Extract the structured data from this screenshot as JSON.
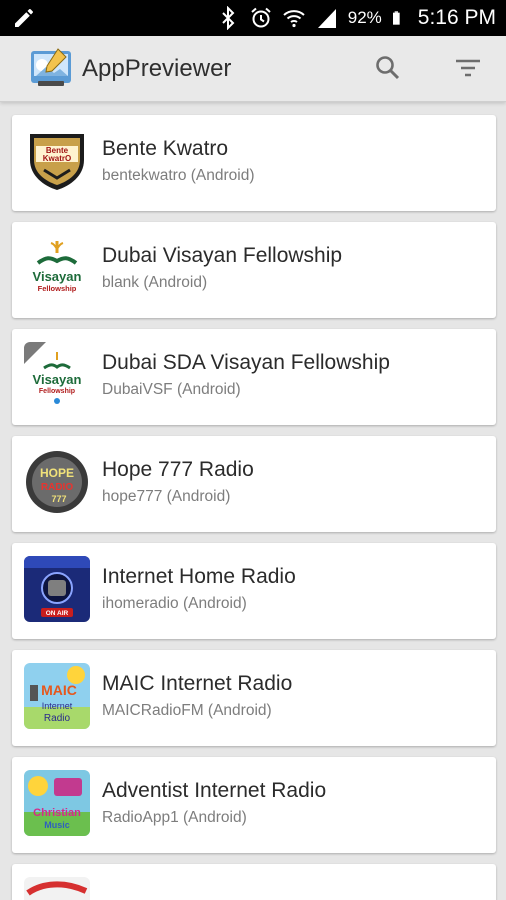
{
  "status_bar": {
    "battery_percent": "92%",
    "time": "5:16 PM",
    "icons": [
      "edit-icon",
      "bluetooth-icon",
      "alarm-icon",
      "wifi-icon",
      "signal-icon",
      "battery-icon"
    ]
  },
  "app_bar": {
    "title": "AppPreviewer",
    "actions": [
      "search-icon",
      "filter-icon"
    ]
  },
  "apps": [
    {
      "name": "Bente Kwatro",
      "subtitle": "bentekwatro (Android)",
      "icon_text": "Bente\nKwatro"
    },
    {
      "name": "Dubai Visayan Fellowship",
      "subtitle": "blank (Android)",
      "icon_text": "Visayan\nFellowship"
    },
    {
      "name": "Dubai SDA Visayan Fellowship",
      "subtitle": "DubaiVSF (Android)",
      "icon_text": "Visayan\nFellowship"
    },
    {
      "name": "Hope 777 Radio",
      "subtitle": "hope777 (Android)",
      "icon_text": "HOPE\nRADIO"
    },
    {
      "name": "Internet Home Radio",
      "subtitle": "ihomeradio (Android)",
      "icon_text": "ON AIR"
    },
    {
      "name": "MAIC Internet Radio",
      "subtitle": "MAICRadioFM (Android)",
      "icon_text": "MAIC\nInternet\nRadio"
    },
    {
      "name": "Adventist Internet Radio",
      "subtitle": "RadioApp1 (Android)",
      "icon_text": "Christian\nMusic"
    }
  ],
  "colors": {
    "app_bar_bg": "#e9e9e9",
    "list_bg": "#e6e6e6",
    "card_bg": "#ffffff",
    "primary_text": "#2b2b2b",
    "secondary_text": "#7d7d7d"
  }
}
